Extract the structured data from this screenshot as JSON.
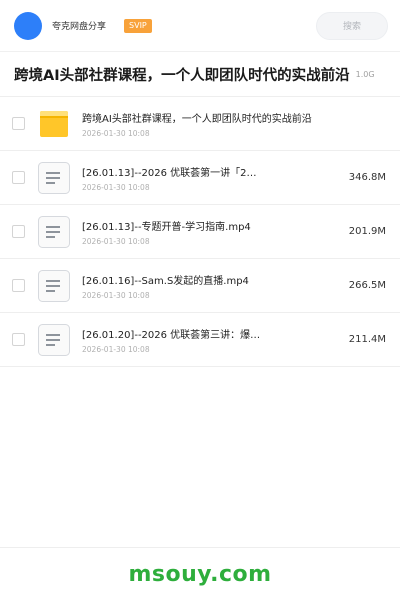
{
  "header": {
    "user_name": "夸克网盘分享",
    "badge": "SVIP",
    "search_placeholder": "搜索",
    "avatar_color": "#2d7ff9"
  },
  "share": {
    "title": "跨境AI头部社群课程，一个人即团队时代的实战前沿",
    "total_size": "1.0G"
  },
  "files": [
    {
      "type": "folder-icon",
      "name": "跨境AI头部社群课程，一个人即团队时代的实战前沿",
      "date": "2026-01-30 10:08",
      "size": ""
    },
    {
      "type": "document-icon",
      "name": "[26.01.13]--2026 优联荟第一讲「2…",
      "date": "2026-01-30 10:08",
      "size": "346.8M"
    },
    {
      "type": "document-icon",
      "name": "[26.01.13]--专题开普-学习指南.mp4",
      "date": "2026-01-30 10:08",
      "size": "201.9M"
    },
    {
      "type": "document-icon",
      "name": "[26.01.16]--Sam.S发起的直播.mp4",
      "date": "2026-01-30 10:08",
      "size": "266.5M"
    },
    {
      "type": "document-icon",
      "name": "[26.01.20]--2026 优联荟第三讲：爆…",
      "date": "2026-01-30 10:08",
      "size": "211.4M"
    }
  ],
  "footer": {
    "watermark": "msouy.com",
    "watermark_color": "#2eae3c"
  }
}
